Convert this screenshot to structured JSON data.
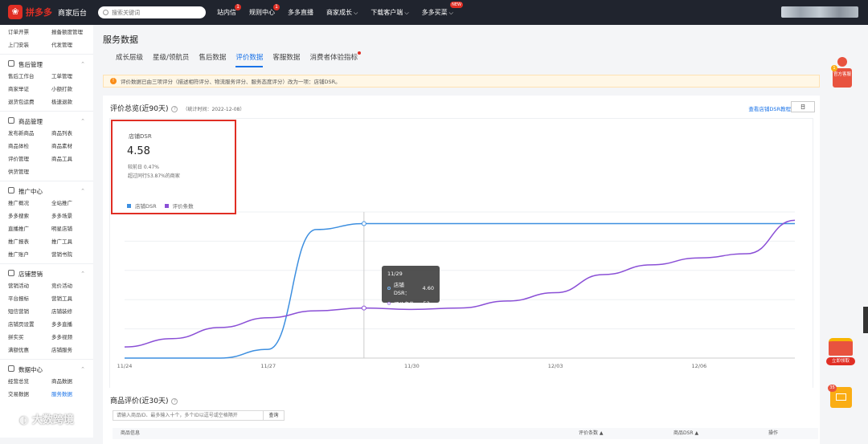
{
  "topbar": {
    "logo_text": "拼多多",
    "logo_sub": "商家后台",
    "search_placeholder": "搜索关键词",
    "nav": [
      {
        "label": "站内信",
        "badge": "1"
      },
      {
        "label": "规则中心",
        "badge": "1"
      },
      {
        "label": "多多直播"
      },
      {
        "label": "商家成长",
        "chevron": true
      },
      {
        "label": "下载客户端",
        "chevron": true
      },
      {
        "label": "多多买菜",
        "chevron": true,
        "new": "NEW"
      }
    ]
  },
  "sidebar": {
    "top_items": [
      "订单开票",
      "报备额度管理",
      "上门安装",
      "代发管理"
    ],
    "groups": [
      {
        "title": "售后管理",
        "items": [
          "售后工作台",
          "工单管理",
          "商家举证",
          "小额打款",
          "退货包运费",
          "极速退款"
        ]
      },
      {
        "title": "商品管理",
        "items": [
          "发布新商品",
          "商品列表",
          "商品体检",
          "商品素材",
          "评价管理",
          "商品工具",
          "供货管理"
        ]
      },
      {
        "title": "推广中心",
        "items": [
          "推广概况",
          "全站推广",
          "多多搜索",
          "多多场景",
          "直播推广",
          "明星店铺",
          "推广报表",
          "推广工具",
          "推广账户",
          "营销书院"
        ]
      },
      {
        "title": "店铺营销",
        "items": [
          "营销活动",
          "竞价活动",
          "平台报标",
          "营销工具",
          "短信营销",
          "店铺装修",
          "店铺页设置",
          "多多直播",
          "拼实买",
          "多多视频",
          "满额优惠",
          "店铺服务"
        ]
      },
      {
        "title": "数据中心",
        "items": [
          "经营总览",
          "商品数据",
          "交易数据",
          "服务数据",
          "服务数据",
          "物流数据"
        ]
      }
    ]
  },
  "main": {
    "page_title": "服务数据",
    "tabs": [
      "成长层级",
      "星级/领航员",
      "售后数据",
      "评价数据",
      "客服数据",
      "消费者体验指标"
    ],
    "active_tab": 3,
    "notice": "评价数据已由三项评分（描述相符评分、物流服务评分、服务态度评分）改为一项：店铺DSR。",
    "overview": {
      "title": "评价总览(近90天)",
      "stat_time": "（统计时间：2022-12-08）",
      "tutorial_link": "查看店铺DSR教程",
      "date_button": "日",
      "metric_label": "店铺DSR",
      "metric_value": "4.58",
      "metric_compare": "较前日  0.47%",
      "metric_beat": "超过同行53.87%的商家"
    },
    "product_reviews": {
      "title": "商品评价(近30天)",
      "search_placeholder": "请输入商品ID、最多输入十个，多个ID以逗号或空格隔开",
      "query_button": "查询",
      "columns": [
        "商品信息",
        "评价条数 ▲",
        "商品DSR ▲",
        "操作"
      ]
    }
  },
  "chart_data": {
    "type": "line",
    "x_ticks": [
      "11/24",
      "11/27",
      "11/30",
      "12/03",
      "12/06"
    ],
    "series": [
      {
        "name": "店铺DSR",
        "color": "#3d8fe0",
        "values": [
          0,
          0,
          0,
          0.3,
          4.4,
          4.6,
          4.6,
          4.6,
          4.6,
          4.6,
          4.6,
          4.6,
          4.6,
          4.6,
          4.6
        ]
      },
      {
        "name": "评价条数",
        "color": "#8a4fd6",
        "values": [
          8,
          14,
          22,
          29,
          34,
          36,
          35,
          36,
          41,
          47,
          60,
          67,
          72,
          75,
          99
        ]
      }
    ],
    "tooltip": {
      "date": "11/29",
      "dsr_label": "店铺DSR：",
      "dsr_value": "4.60",
      "count_label": "评价条数：",
      "count_value": "52"
    }
  },
  "right_widgets": {
    "kefu_label": "官方客服",
    "kefu_badge": "1",
    "coupon_label": "立即领取",
    "mail_badge": "35"
  },
  "watermark": "大数跨境"
}
